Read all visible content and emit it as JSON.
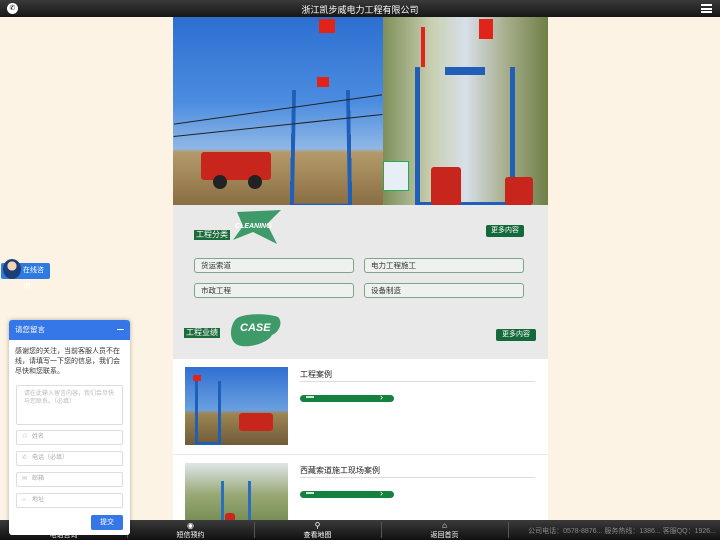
{
  "header": {
    "title": "浙江凯步威电力工程有限公司",
    "phone_icon": "phone-icon",
    "menu_icon": "hamburger-menu-icon"
  },
  "category_section": {
    "title": "工程分类",
    "badge_text": "CLEANING",
    "more_label": "更多内容",
    "items": [
      {
        "label": "货运索道"
      },
      {
        "label": "电力工程施工"
      },
      {
        "label": "市政工程"
      },
      {
        "label": "设备制造"
      }
    ]
  },
  "case_section": {
    "title": "工程业绩",
    "badge_text": "CASE",
    "more_label": "更多内容",
    "cases": [
      {
        "name": "工程案例"
      },
      {
        "name": "西藏索道施工现场案例"
      }
    ]
  },
  "online_service": {
    "label": "在线咨询"
  },
  "chat_widget": {
    "title": "请您留言",
    "message": "感谢您的关注，当前客服人员不在线，请填写一下您的信息，我们会尽快和您联系。",
    "textarea_placeholder": "请在此输入留言内容，我们会尽快与您联系。（必填）",
    "fields": [
      {
        "placeholder": "姓名",
        "icon": "user-icon"
      },
      {
        "placeholder": "电话（必填）",
        "icon": "phone-icon"
      },
      {
        "placeholder": "邮箱",
        "icon": "mail-icon"
      },
      {
        "placeholder": "地址",
        "icon": "location-icon"
      }
    ],
    "submit_label": "提交"
  },
  "bottom_nav": {
    "items": [
      {
        "label": "电话咨询",
        "icon": "phone-icon"
      },
      {
        "label": "短信预约",
        "icon": "message-icon"
      },
      {
        "label": "查看地图",
        "icon": "map-pin-icon"
      },
      {
        "label": "返回首页",
        "icon": "home-icon"
      }
    ],
    "info": "公司电话：0578-8876... 服务热线：1386... 客服QQ：1926..."
  },
  "colors": {
    "accent_green": "#14693a",
    "chat_blue": "#3577e6",
    "background": "#fdf3e4"
  }
}
